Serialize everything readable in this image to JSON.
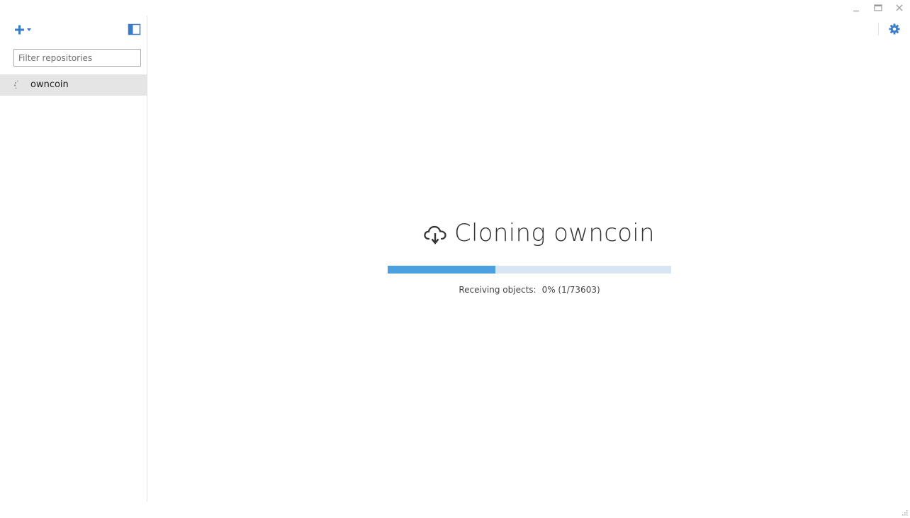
{
  "sidebar": {
    "filter": {
      "placeholder": "Filter repositories",
      "value": ""
    },
    "repositories": [
      {
        "name": "owncoin",
        "state": "cloning"
      }
    ]
  },
  "clone": {
    "title": "Cloning owncoin",
    "status_label": "Receiving objects:",
    "status_value": "0% (1/73603)",
    "progress_fraction": 0.38
  },
  "colors": {
    "accent": "#3a7bc8",
    "progress_fill": "#4ba0e0",
    "progress_track": "#d8e6f4",
    "selected_row": "#e5e5e5"
  },
  "icons": {
    "add": "plus-icon",
    "add_dropdown": "caret-down-icon",
    "toggle_sidebar": "sidebar-toggle-icon",
    "repo_state": "spinner-icon",
    "settings": "gear-icon",
    "clone": "cloud-download-icon",
    "minimize": "minimize-icon",
    "maximize": "maximize-icon",
    "close": "close-icon"
  }
}
